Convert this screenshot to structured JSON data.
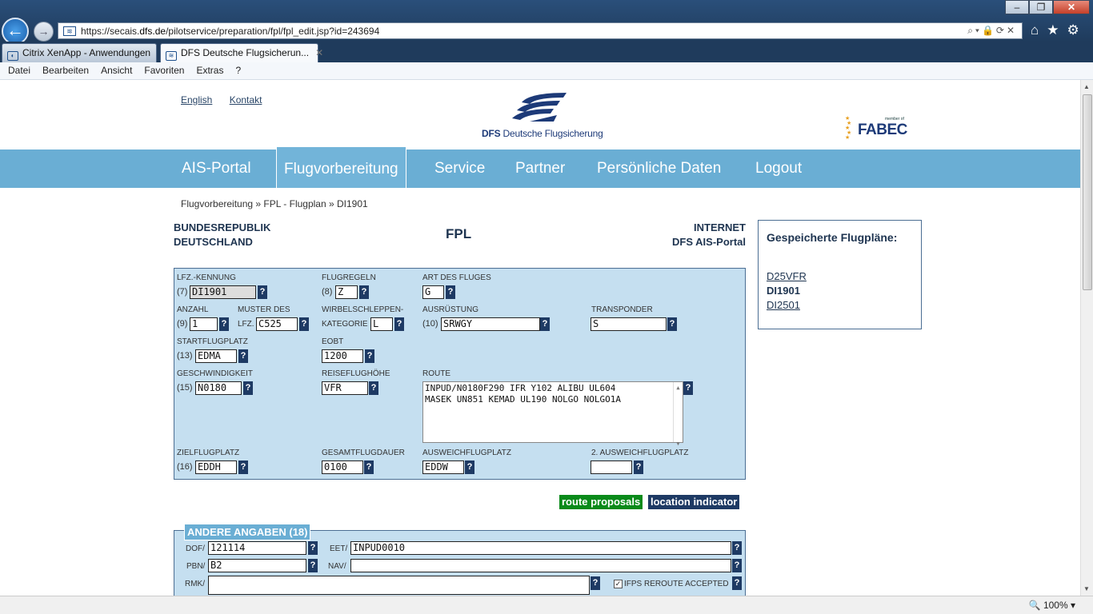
{
  "browser": {
    "url_prefix": "https://secais.",
    "url_domain": "dfs.de",
    "url_path": "/pilotservice/preparation/fpl/fpl_edit.jsp?id=243694",
    "tabs": [
      {
        "label": "Citrix XenApp - Anwendungen"
      },
      {
        "label": "DFS Deutsche Flugsicherun...",
        "close": "✕"
      }
    ],
    "menu": [
      "Datei",
      "Bearbeiten",
      "Ansicht",
      "Favoriten",
      "Extras",
      "?"
    ],
    "zoom": "100%"
  },
  "header": {
    "links": [
      "English",
      "Kontakt"
    ],
    "logo_brand_bold": "DFS",
    "logo_brand_text": "Deutsche Flugsicherung",
    "fabec_member": "member of",
    "fabec_name": "FABEC"
  },
  "nav": {
    "items": [
      "AIS-Portal",
      "Flugvorbereitung",
      "Service",
      "Partner",
      "Persönliche Daten",
      "Logout"
    ]
  },
  "breadcrumb": "Flugvorbereitung » FPL - Flugplan » DI1901",
  "page": {
    "left_title_1": "BUNDESREPUBLIK",
    "left_title_2": "DEUTSCHLAND",
    "center_title": "FPL",
    "right_title_1": "INTERNET",
    "right_title_2": "DFS AIS-Portal"
  },
  "form": {
    "lfz_kennung": {
      "label": "LFZ.-KENNUNG",
      "num": "(7)",
      "value": "DI1901"
    },
    "flugregeln": {
      "label": "FLUGREGELN",
      "num": "(8)",
      "value": "Z"
    },
    "art_des_fluges": {
      "label": "ART DES FLUGES",
      "value": "G"
    },
    "anzahl": {
      "label": "ANZAHL",
      "num": "(9)",
      "value": "1"
    },
    "muster": {
      "label": "MUSTER DES",
      "label2": "LFZ.",
      "value": "C525"
    },
    "wirbel": {
      "label": "WIRBELSCHLEPPEN-",
      "label2": "KATEGORIE",
      "value": "L"
    },
    "ausruestung": {
      "label": "AUSRÜSTUNG",
      "num": "(10)",
      "value": "SRWGY"
    },
    "transponder": {
      "label": "TRANSPONDER",
      "value": "S"
    },
    "startflugplatz": {
      "label": "STARTFLUGPLATZ",
      "num": "(13)",
      "value": "EDMA"
    },
    "eobt": {
      "label": "EOBT",
      "value": "1200"
    },
    "geschwindigkeit": {
      "label": "GESCHWINDIGKEIT",
      "num": "(15)",
      "value": "N0180"
    },
    "reiseflughoehe": {
      "label": "REISEFLUGHÖHE",
      "value": "VFR"
    },
    "route": {
      "label": "ROUTE",
      "line1": "INPUD/N0180F290 IFR Y102 ALIBU UL604",
      "line2": "MASEK UN851 KEMAD UL190 NOLGO NOLGO1A"
    },
    "zielflugplatz": {
      "label": "ZIELFLUGPLATZ",
      "num": "(16)",
      "value": "EDDH"
    },
    "gesamtflugdauer": {
      "label": "GESAMTFLUGDAUER",
      "value": "0100"
    },
    "ausweich": {
      "label": "AUSWEICHFLUGPLATZ",
      "value": "EDDW"
    },
    "ausweich2": {
      "label": "2. AUSWEICHFLUGPLATZ",
      "value": ""
    },
    "help": "?"
  },
  "buttons": {
    "route_proposals": "route proposals",
    "location_indicator": "location indicator"
  },
  "other": {
    "legend": "ANDERE ANGABEN (18)",
    "dof_label": "DOF/",
    "dof": "121114",
    "eet_label": "EET/",
    "eet": "INPUD0010",
    "pbn_label": "PBN/",
    "pbn": "B2",
    "nav_label": "NAV/",
    "nav": "",
    "rmk_label": "RMK/",
    "rmk": "",
    "ifps_label": "IFPS REROUTE ACCEPTED"
  },
  "saved": {
    "title": "Gespeicherte Flugpläne:",
    "items": [
      "D25VFR",
      "DI1901",
      "DI2501"
    ]
  }
}
